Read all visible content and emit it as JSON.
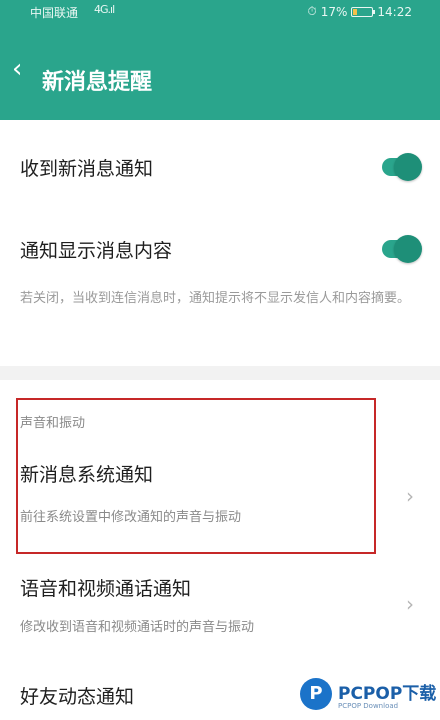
{
  "status_bar": {
    "carrier": "中国联通",
    "signal": "4G.ıl",
    "battery_percent": "17%",
    "time": "14:22"
  },
  "header": {
    "back_icon": "chevron-left-icon",
    "title": "新消息提醒"
  },
  "settings": {
    "receive_new": {
      "label": "收到新消息通知",
      "enabled": true
    },
    "show_content": {
      "label": "通知显示消息内容",
      "enabled": true
    },
    "content_note": "若关闭，当收到连信消息时，通知提示将不显示发信人和内容摘要。"
  },
  "sound_section": {
    "header": "声音和振动",
    "system_notify": {
      "label": "新消息系统通知",
      "sub": "前往系统设置中修改通知的声音与振动"
    },
    "voice_video": {
      "label": "语音和视频通话通知",
      "sub": "修改收到语音和视频通话时的声音与振动"
    },
    "friend_feed": {
      "label": "好友动态通知"
    }
  },
  "watermark": {
    "brand": "PCPOP下载",
    "sub": "PCPOP Download"
  },
  "colors": {
    "accent": "#2aa58c",
    "highlight": "#c62828"
  }
}
